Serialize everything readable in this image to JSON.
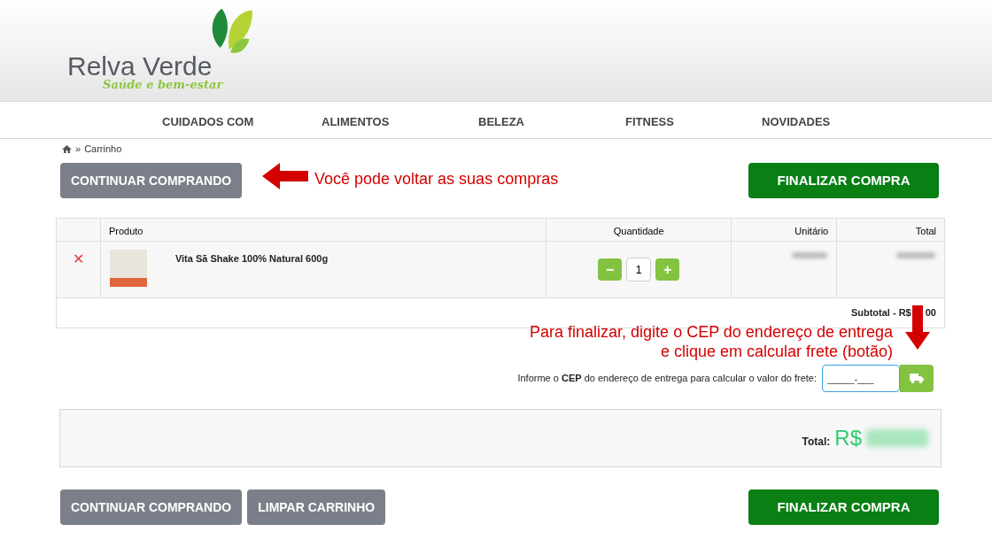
{
  "logo": {
    "name": "Relva Verde",
    "tagline": "Saúde e bem-estar"
  },
  "nav": [
    "CUIDADOS COM",
    "ALIMENTOS",
    "BELEZA",
    "FITNESS",
    "NOVIDADES"
  ],
  "breadcrumb": {
    "separator": "»",
    "items": [
      "Carrinho"
    ]
  },
  "top_buttons": {
    "continue": "CONTINUAR COMPRANDO",
    "finish": "FINALIZAR COMPRA"
  },
  "annotations": [
    {
      "kind": "left-arrow",
      "text": "Você pode voltar as suas compras"
    },
    {
      "kind": "down-arrow",
      "text": "Para finalizar, digite o CEP do endereço de entrega\ne clique em calcular frete (botão)"
    }
  ],
  "table": {
    "columns": [
      "",
      "Produto",
      "Quantidade",
      "Unitário",
      "Total"
    ],
    "rows": [
      {
        "product": "Vita Sã Shake 100% Natural 600g",
        "remove": "✕",
        "quantity": "1",
        "minus": "−",
        "plus": "+"
      }
    ],
    "subtotal": [
      "Subtotal - R$",
      "00"
    ]
  },
  "shipping": {
    "label": "Informe o **CEP** do endereço de entrega para calcular o valor do frete:",
    "placeholder": "_____-___"
  },
  "total": {
    "label": "Total:",
    "currency": "R$"
  },
  "bottom_buttons": {
    "continue": "CONTINUAR COMPRANDO",
    "clear": "LIMPAR CARRINHO",
    "finish": "FINALIZAR COMPRA"
  }
}
